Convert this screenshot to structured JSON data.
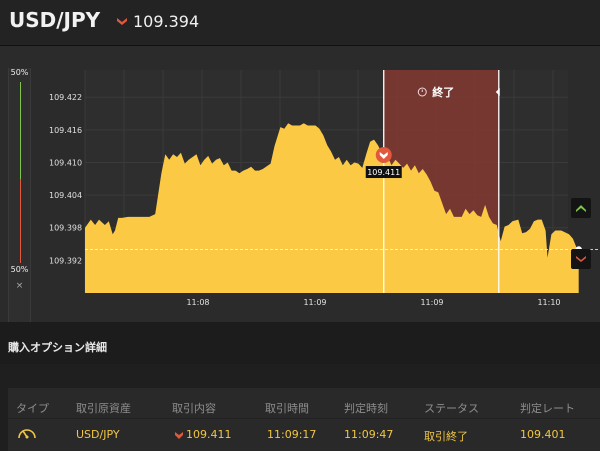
{
  "header": {
    "pair": "USD/JPY",
    "direction": "down",
    "price": "109.394"
  },
  "gauge": {
    "top_label": "50%",
    "bottom_label": "50%",
    "close_label": "×"
  },
  "chart_data": {
    "type": "area",
    "title": "",
    "xlabel": "",
    "ylabel": "",
    "ylim": [
      109.386,
      109.427
    ],
    "y_ticks": [
      "109.422",
      "109.416",
      "109.410",
      "109.404",
      "109.398",
      "109.392"
    ],
    "x_ticks": [
      "11:08",
      "11:09",
      "11:09",
      "11:10"
    ],
    "x_tick_seconds": [
      30,
      60,
      90,
      120
    ],
    "grid": true,
    "fill_color": "#fbc944",
    "band_color": "#8b3a32",
    "series": [
      {
        "values": [
          [
            0,
            109.398
          ],
          [
            1.5,
            109.3995
          ],
          [
            2.6,
            109.3985
          ],
          [
            3.6,
            109.3995
          ],
          [
            5.1,
            109.3985
          ],
          [
            6.1,
            109.3992
          ],
          [
            7.1,
            109.3968
          ],
          [
            7.7,
            109.3975
          ],
          [
            8.5,
            109.3998
          ],
          [
            9.5,
            109.3998
          ],
          [
            11,
            109.4
          ],
          [
            12.5,
            109.4
          ],
          [
            14.5,
            109.4
          ],
          [
            16.5,
            109.4
          ],
          [
            18,
            109.4005
          ],
          [
            19.6,
            109.408
          ],
          [
            20.6,
            109.4115
          ],
          [
            21.6,
            109.4105
          ],
          [
            22.6,
            109.4115
          ],
          [
            23.6,
            109.411
          ],
          [
            24.6,
            109.4118
          ],
          [
            25.6,
            109.4098
          ],
          [
            26.6,
            109.4105
          ],
          [
            27.6,
            109.411
          ],
          [
            28.6,
            109.4115
          ],
          [
            29.6,
            109.4095
          ],
          [
            30.6,
            109.4105
          ],
          [
            31.6,
            109.4112
          ],
          [
            32.6,
            109.4098
          ],
          [
            33.6,
            109.4105
          ],
          [
            34.6,
            109.4108
          ],
          [
            35.6,
            109.4095
          ],
          [
            36.6,
            109.41
          ],
          [
            37.6,
            109.4085
          ],
          [
            38.6,
            109.4085
          ],
          [
            39.6,
            109.408
          ],
          [
            40.6,
            109.4085
          ],
          [
            41.6,
            109.4088
          ],
          [
            42.6,
            109.4092
          ],
          [
            43.6,
            109.4085
          ],
          [
            44.6,
            109.4085
          ],
          [
            45.6,
            109.4088
          ],
          [
            47.6,
            109.4098
          ],
          [
            48.6,
            109.413
          ],
          [
            50.1,
            109.4165
          ],
          [
            51.1,
            109.4162
          ],
          [
            52.1,
            109.4172
          ],
          [
            53.1,
            109.4168
          ],
          [
            55.1,
            109.4168
          ],
          [
            56.1,
            109.4172
          ],
          [
            57.1,
            109.4168
          ],
          [
            59.1,
            109.4168
          ],
          [
            60.1,
            109.4162
          ],
          [
            61.1,
            109.415
          ],
          [
            62.1,
            109.4132
          ],
          [
            63.1,
            109.412
          ],
          [
            64.1,
            109.4105
          ],
          [
            65.1,
            109.411
          ],
          [
            66.1,
            109.4095
          ],
          [
            67.1,
            109.4105
          ],
          [
            68.1,
            109.4095
          ],
          [
            69.1,
            109.41
          ],
          [
            70.1,
            109.4098
          ],
          [
            71.1,
            109.409
          ],
          [
            72.1,
            109.4115
          ],
          [
            73.1,
            109.4138
          ],
          [
            74.1,
            109.4142
          ],
          [
            75.1,
            109.4132
          ],
          [
            76.6,
            109.4111
          ],
          [
            77.6,
            109.4111
          ],
          [
            78.6,
            109.4095
          ],
          [
            79.6,
            109.4105
          ],
          [
            80.6,
            109.4098
          ],
          [
            81.6,
            109.409
          ],
          [
            82.6,
            109.4098
          ],
          [
            83.6,
            109.4085
          ],
          [
            84.6,
            109.4095
          ],
          [
            85.6,
            109.408
          ],
          [
            86.6,
            109.4088
          ],
          [
            87.6,
            109.4078
          ],
          [
            88.6,
            109.4065
          ],
          [
            89.6,
            109.4048
          ],
          [
            90.6,
            109.4045
          ],
          [
            91.6,
            109.4025
          ],
          [
            92.6,
            109.4005
          ],
          [
            93.6,
            109.4015
          ],
          [
            94.6,
            109.4
          ],
          [
            95.6,
            109.4
          ],
          [
            96.6,
            109.4
          ],
          [
            97.6,
            109.4015
          ],
          [
            98.6,
            109.4005
          ],
          [
            99.6,
            109.4012
          ],
          [
            100.6,
            109.4003
          ],
          [
            101.6,
            109.4
          ],
          [
            102.6,
            109.4022
          ],
          [
            103.6,
            109.4
          ],
          [
            104.6,
            109.3988
          ],
          [
            105.6,
            109.3985
          ],
          [
            106.6,
            109.3955
          ],
          [
            107.6,
            109.3982
          ],
          [
            108.6,
            109.3985
          ],
          [
            109.6,
            109.3992
          ],
          [
            111.1,
            109.3995
          ],
          [
            112.1,
            109.397
          ],
          [
            113.1,
            109.3972
          ],
          [
            114.1,
            109.3978
          ],
          [
            115.1,
            109.3992
          ],
          [
            116.1,
            109.3995
          ],
          [
            117.1,
            109.3995
          ],
          [
            118.1,
            109.3975
          ],
          [
            118.6,
            109.3925
          ],
          [
            119.6,
            109.3968
          ],
          [
            120.6,
            109.3975
          ],
          [
            122.1,
            109.3975
          ],
          [
            124.1,
            109.3968
          ],
          [
            125.1,
            109.396
          ],
          [
            126.1,
            109.3942
          ],
          [
            126.6,
            109.394
          ]
        ]
      }
    ],
    "band_x": [
      76.6,
      106.1
    ],
    "entry_x": 76.6,
    "entry_rate": "109.411",
    "current_rate": 109.394,
    "band_label": "終了"
  },
  "section": {
    "title": "購入オプション詳細"
  },
  "table": {
    "columns": [
      "タイプ",
      "取引原資産",
      "取引内容",
      "取引時間",
      "判定時刻",
      "ステータス",
      "判定レート"
    ],
    "row": {
      "type_icon": "gauge-icon",
      "asset": "USD/JPY",
      "direction": "down",
      "rate": "109.411",
      "trade_time": "11:09:17",
      "judge_time": "11:09:47",
      "status": "取引終了",
      "judge_rate": "109.401"
    }
  },
  "colors": {
    "accent": "#f2c744",
    "down": "#e0593e",
    "up": "#7ec54a",
    "band": "#8b3a32"
  }
}
